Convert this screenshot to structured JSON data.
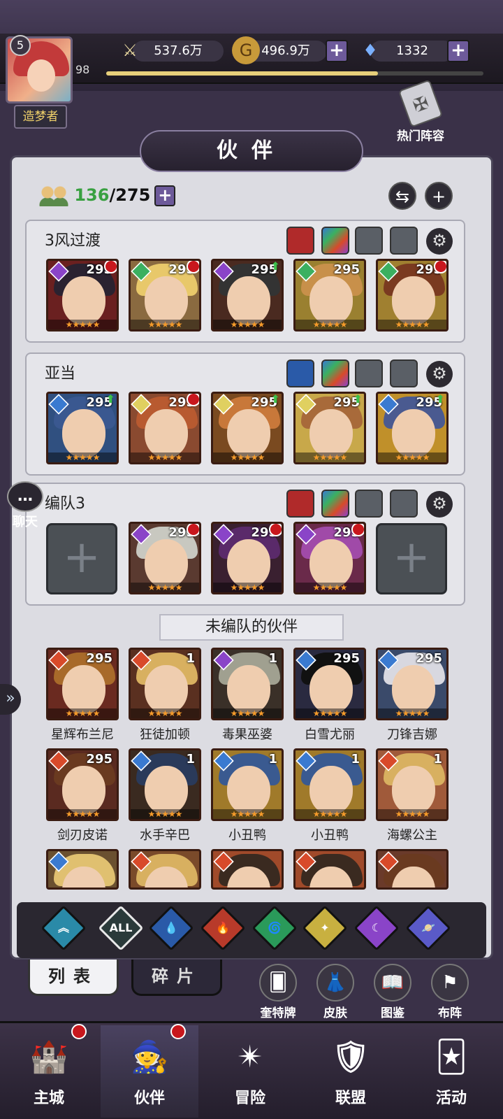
{
  "header": {
    "player_level": "5",
    "player_title": "造梦者",
    "exp_level": "98",
    "exp_progress": 0.72,
    "power": "537.6万",
    "gold": "496.9万",
    "gems": "1332",
    "hot_team_label": "热门阵容"
  },
  "page_title": "伙伴",
  "roster": {
    "current": "136",
    "max": "/275"
  },
  "teams": [
    {
      "name": "3风过渡",
      "heroes": [
        {
          "level": "295",
          "element": "#8a44c8",
          "hair": "#2a2230",
          "bg": "#6a2020",
          "stars": "★★★★★",
          "badge": "dot"
        },
        {
          "level": "295",
          "element": "#3bb060",
          "hair": "#e8c86a",
          "bg": "#8a6a40",
          "stars": "★★★★★",
          "badge": "dot"
        },
        {
          "level": "295",
          "element": "#8a44c8",
          "hair": "#333",
          "bg": "#4a2a20",
          "stars": "★★★★★",
          "badge": "arrow"
        },
        {
          "level": "295",
          "element": "#3bb060",
          "hair": "#c8904a",
          "bg": "#9a8030",
          "stars": "★★★★★",
          "badge": "none"
        },
        {
          "level": "295",
          "element": "#3bb060",
          "hair": "#7a3a20",
          "bg": "#a08030",
          "stars": "★★★★★",
          "badge": "dot"
        }
      ]
    },
    {
      "name": "亚当",
      "heroes": [
        {
          "level": "295",
          "element": "#3a7ad0",
          "hair": "#3a5890",
          "bg": "#305080",
          "stars": "★★★★★",
          "badge": "arrow"
        },
        {
          "level": "295",
          "element": "#e0d060",
          "hair": "#b85a30",
          "bg": "#8a4a30",
          "stars": "★★★★★",
          "badge": "dot"
        },
        {
          "level": "295",
          "element": "#e0d060",
          "hair": "#c8783a",
          "bg": "#7a4a20",
          "stars": "★★★★★",
          "badge": "arrow"
        },
        {
          "level": "295",
          "element": "#e0d060",
          "hair": "#a86a3a",
          "bg": "#c8a84a",
          "stars": "★★★★★",
          "badge": "arrow"
        },
        {
          "level": "295",
          "element": "#3a7ad0",
          "hair": "#4a5a90",
          "bg": "#c0902a",
          "stars": "★★★★★",
          "badge": "arrow"
        }
      ]
    },
    {
      "name": "编队3",
      "heroes": [
        null,
        {
          "level": "295",
          "element": "#8a44c8",
          "hair": "#c8c8c0",
          "bg": "#5a3a30",
          "stars": "★★★★★",
          "badge": "dot"
        },
        {
          "level": "295",
          "element": "#8a44c8",
          "hair": "#5a2a6a",
          "bg": "#3a2030",
          "stars": "★★★★★",
          "badge": "dot"
        },
        {
          "level": "295",
          "element": "#8a44c8",
          "hair": "#a04aa8",
          "bg": "#6a2a4a",
          "stars": "★★★★★",
          "badge": "dot"
        },
        null
      ]
    }
  ],
  "unassigned_title": "未编队的伙伴",
  "unassigned": [
    {
      "name": "星辉布兰尼",
      "level": "295",
      "element": "#d84a2a",
      "hair": "#a86a2a",
      "bg": "#6a2a20",
      "stars": "★★★★★"
    },
    {
      "name": "狂徒加顿",
      "level": "1",
      "element": "#d84a2a",
      "hair": "#d8b060",
      "bg": "#5a3020",
      "stars": "★★★★★"
    },
    {
      "name": "毒果巫婆",
      "level": "1",
      "element": "#8a44c8",
      "hair": "#a0a090",
      "bg": "#3a3028",
      "stars": "★★★★★"
    },
    {
      "name": "白雪尤丽",
      "level": "295",
      "element": "#3a7ad0",
      "hair": "#111",
      "bg": "#2a2a40",
      "stars": "★★★★★"
    },
    {
      "name": "刀锋吉娜",
      "level": "295",
      "element": "#3a7ad0",
      "hair": "#d8d8e0",
      "bg": "#3a4a6a",
      "stars": "★★★★★"
    },
    {
      "name": "剑刃皮诺",
      "level": "295",
      "element": "#d84a2a",
      "hair": "#6a3a20",
      "bg": "#5a2a20",
      "stars": "★★★★★"
    },
    {
      "name": "水手辛巴",
      "level": "1",
      "element": "#3a7ad0",
      "hair": "#2a3a5a",
      "bg": "#3a2a20",
      "stars": "★★★★★"
    },
    {
      "name": "小丑鸭",
      "level": "1",
      "element": "#3a7ad0",
      "hair": "#3a5a90",
      "bg": "#a07a2a",
      "stars": "★★★★★"
    },
    {
      "name": "小丑鸭",
      "level": "1",
      "element": "#3a7ad0",
      "hair": "#3a5a90",
      "bg": "#a07a2a",
      "stars": "★★★★★"
    },
    {
      "name": "海螺公主",
      "level": "1",
      "element": "#d84a2a",
      "hair": "#d8b060",
      "bg": "#a05a3a",
      "stars": "★★★★★"
    }
  ],
  "partial_row": [
    {
      "element": "#3a7ad0",
      "hair": "#e0c070",
      "bg": "#6a5030"
    },
    {
      "element": "#d84a2a",
      "hair": "#d8b060",
      "bg": "#7a4a2a"
    },
    {
      "element": "#d84a2a",
      "hair": "#3a2a20",
      "bg": "#a04a2a"
    },
    {
      "element": "#d84a2a",
      "hair": "#3a2a20",
      "bg": "#a04a2a"
    },
    {
      "element": "#d84a2a",
      "hair": "#6a3a20",
      "bg": "#6a3a2a"
    }
  ],
  "filters": [
    {
      "id": "top",
      "color": "#2a8aa8",
      "glyph": "︽"
    },
    {
      "id": "all",
      "color": "#2a3a3a",
      "glyph": "ALL"
    },
    {
      "id": "water",
      "color": "#2a5aa8",
      "glyph": "💧"
    },
    {
      "id": "fire",
      "color": "#b83a2a",
      "glyph": "🔥"
    },
    {
      "id": "wind",
      "color": "#2a9a5a",
      "glyph": "🌀"
    },
    {
      "id": "light",
      "color": "#c8b040",
      "glyph": "✦"
    },
    {
      "id": "dark",
      "color": "#8a44c8",
      "glyph": "☾"
    },
    {
      "id": "void",
      "color": "#5a5ac8",
      "glyph": "🪐"
    }
  ],
  "tabs": {
    "list": "列表",
    "shards": "碎片"
  },
  "tools": [
    "奎特牌",
    "皮肤",
    "图鉴",
    "布阵"
  ],
  "chat_label": "聊天",
  "nav": [
    "主城",
    "伙伴",
    "冒险",
    "联盟",
    "活动"
  ]
}
